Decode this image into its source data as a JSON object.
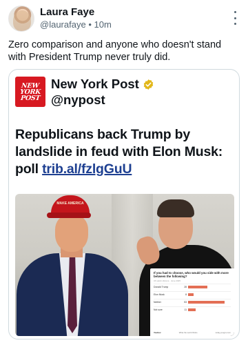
{
  "post": {
    "author_name": "Laura Faye",
    "handle": "@laurafaye",
    "separator": "•",
    "time": "10m",
    "text": "Zero comparison and anyone who doesn't stand with President Trump never truly did."
  },
  "quoted": {
    "logo_text": [
      "NEW",
      "YORK",
      "POST"
    ],
    "name": "New York Post",
    "handle": "@nypost",
    "headline": "Republicans back Trump by landslide in feud with Elon Musk: poll",
    "link": "trib.al/fzlgGuU",
    "photo_hat_text": "MAKE AMERICA"
  },
  "poll": {
    "question": "If you had to choose, who would you side with more between the following?",
    "subtitle": "US adult citizens · June 2025",
    "rows": [
      {
        "label": "Donald Trump",
        "pct": "28",
        "value": 28
      },
      {
        "label": "Elon Musk",
        "pct": "8",
        "value": 8
      },
      {
        "label": "Neither",
        "pct": "53",
        "value": 53
      },
      {
        "label": "Not sure",
        "pct": "11",
        "value": 11
      }
    ],
    "footer_left": "YouGov",
    "footer_mid": "What the world thinks",
    "footer_right": "today.yougov.com"
  },
  "colors": {
    "nyp_red": "#d71921",
    "link_blue": "#1d3f91",
    "verified_gold": "#e2b719",
    "poll_bar": "#e36f55"
  },
  "icons": {
    "more": "kebab-vertical",
    "verified": "gold-verified-badge"
  }
}
